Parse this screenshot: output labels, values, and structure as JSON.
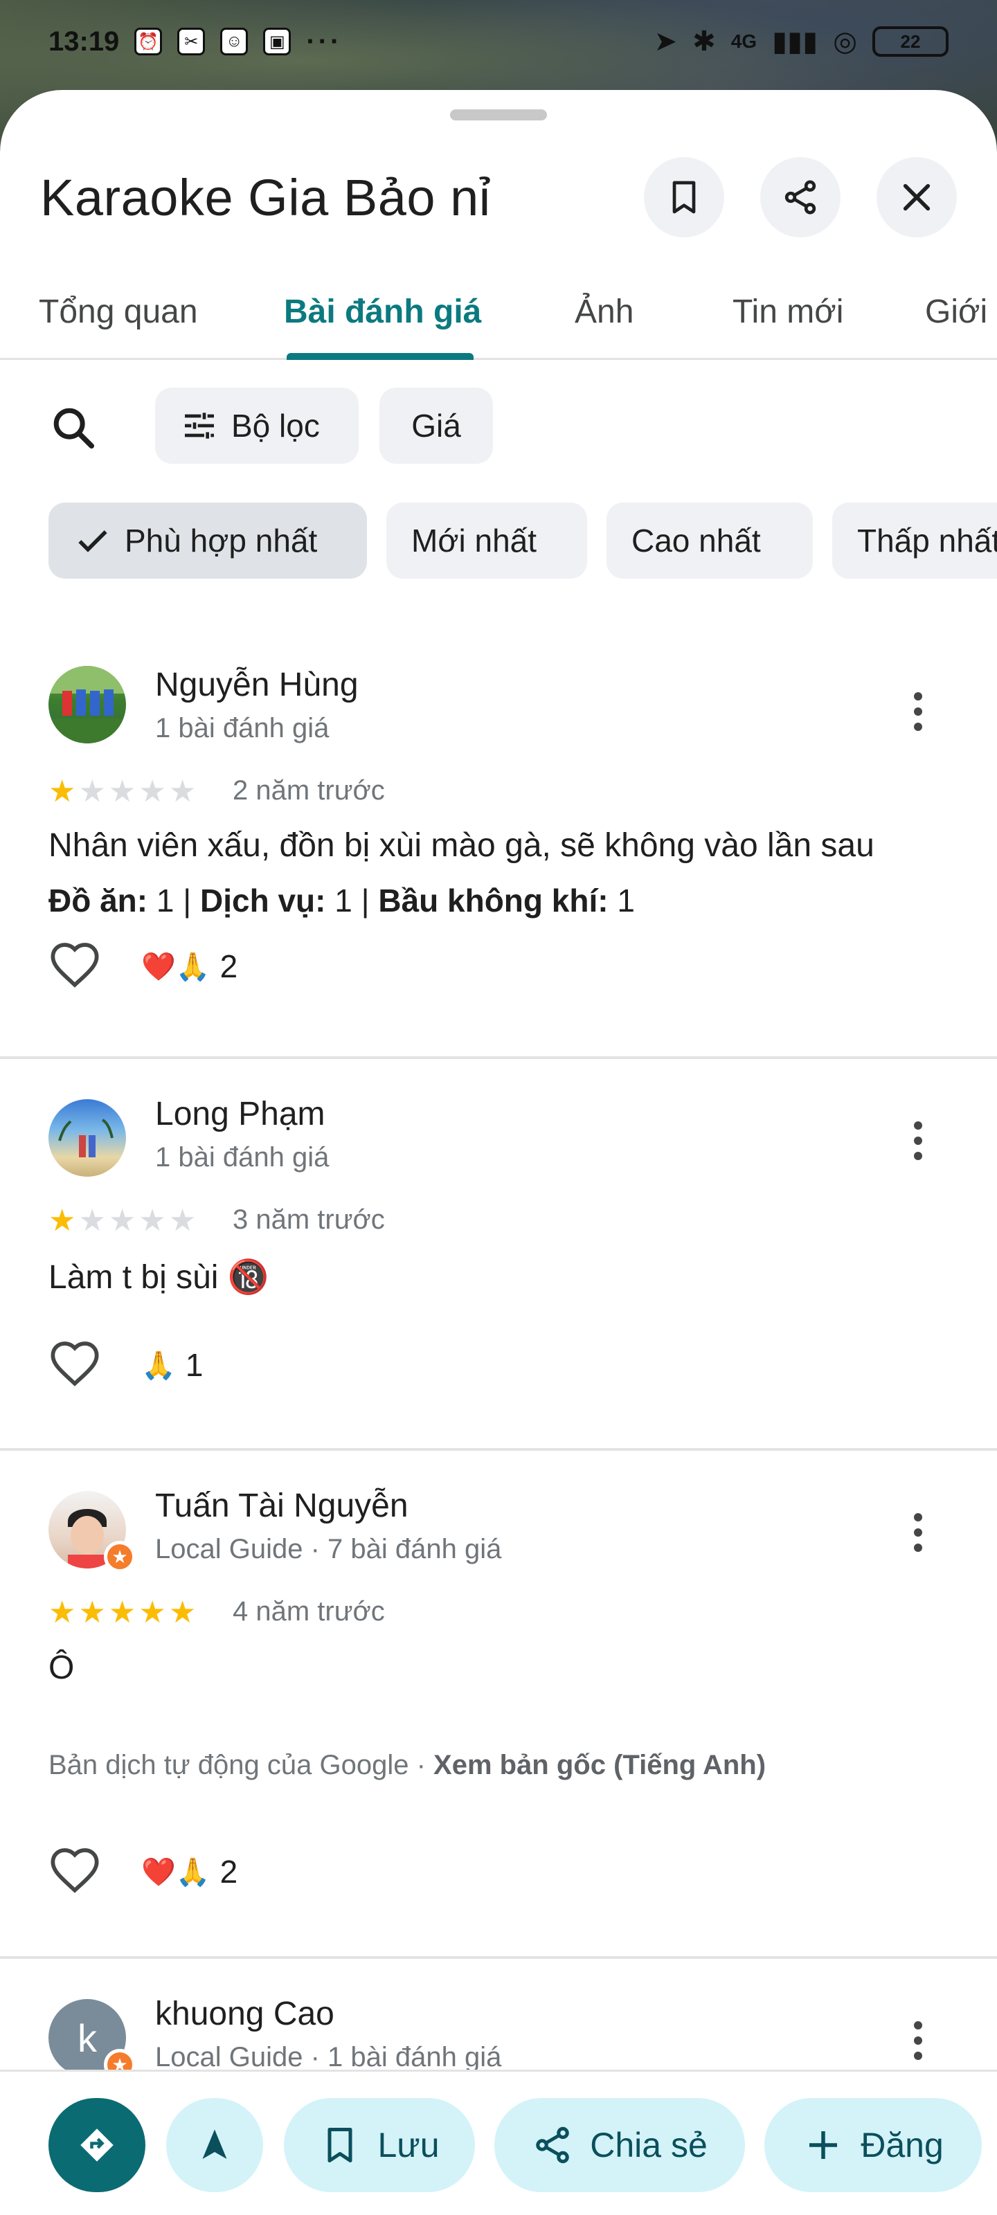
{
  "status_bar": {
    "time": "13:19",
    "signal_label": "4G",
    "battery": "22"
  },
  "place": {
    "title": "Karaoke Gia Bảo nỉ"
  },
  "tabs": [
    {
      "label": "Tổng quan"
    },
    {
      "label": "Bài đánh giá"
    },
    {
      "label": "Ảnh"
    },
    {
      "label": "Tin mới"
    },
    {
      "label": "Giới thiệu"
    }
  ],
  "filters": {
    "filter_label": "Bộ lọc",
    "price_label": "Giá"
  },
  "sort_options": [
    {
      "label": "Phù hợp nhất",
      "selected": true
    },
    {
      "label": "Mới nhất"
    },
    {
      "label": "Cao nhất"
    },
    {
      "label": "Thấp nhất"
    }
  ],
  "reviews": [
    {
      "name": "Nguyễn Hùng",
      "subtitle": "1 bài đánh giá",
      "rating": 1,
      "time": "2 năm trước",
      "text": "Nhân viên xấu, đồn bị xùi mào gà, sẽ không vào lần sau",
      "meta": {
        "food_label": "Đồ ăn:",
        "food_value": " 1 | ",
        "service_label": "Dịch vụ:",
        "service_value": " 1 | ",
        "ambience_label": "Bầu không khí:",
        "ambience_value": " 1"
      },
      "reactions": "❤️🙏",
      "reaction_count": "2"
    },
    {
      "name": "Long Phạm",
      "subtitle": "1 bài đánh giá",
      "rating": 1,
      "time": "3 năm trước",
      "text": "Làm t bị sùi 🔞",
      "reactions": "🙏",
      "reaction_count": "1"
    },
    {
      "name": "Tuấn Tài Nguyễn",
      "subtitle": "Local Guide · 7 bài đánh giá",
      "rating": 5,
      "time": "4 năm trước",
      "text": "Ô",
      "translation_note": "Bản dịch tự động của Google · ",
      "translation_link": "Xem bản gốc (Tiếng Anh)",
      "reactions": "❤️🙏",
      "reaction_count": "2"
    },
    {
      "name": "khuong Cao",
      "subtitle": "Local Guide · 1 bài đánh giá",
      "avatar_letter": "k"
    }
  ],
  "bottom_actions": {
    "save_label": "Lưu",
    "share_label": "Chia sẻ",
    "post_label": "Đăng"
  },
  "colors": {
    "accent": "#0b7a80",
    "star": "#fbbc04",
    "fab_bg": "#d3f3f8",
    "primary_fab": "#0b6b73"
  }
}
